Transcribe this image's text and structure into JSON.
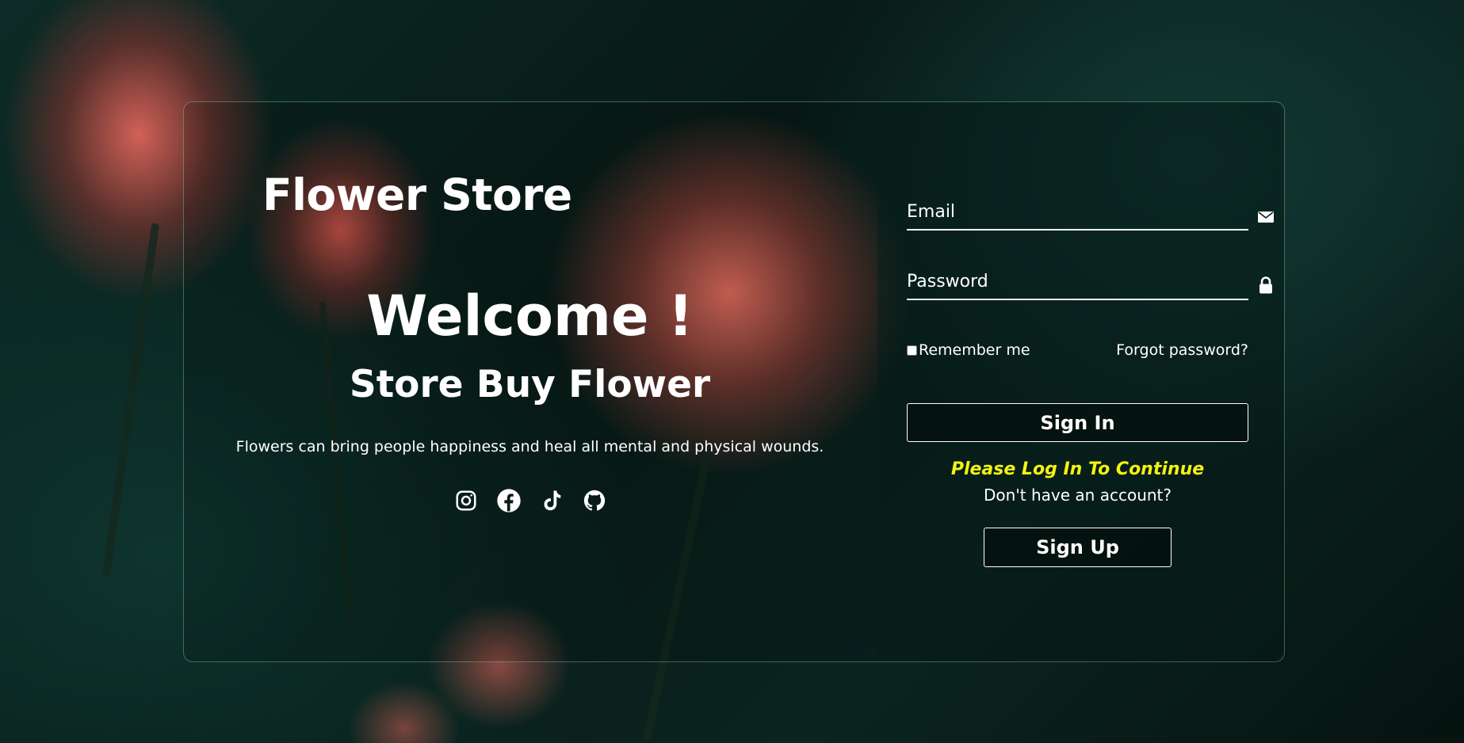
{
  "brand": {
    "title": "Flower Store"
  },
  "hero": {
    "welcome": "Welcome !",
    "subtitle": "Store Buy Flower",
    "tagline": "Flowers can bring people happiness and heal all mental and physical wounds."
  },
  "socials": [
    {
      "icon": "instagram-icon"
    },
    {
      "icon": "facebook-icon"
    },
    {
      "icon": "tiktok-icon"
    },
    {
      "icon": "github-icon"
    }
  ],
  "form": {
    "email": {
      "placeholder": "Email",
      "value": "",
      "icon": "envelope-icon"
    },
    "password": {
      "placeholder": "Password",
      "value": "",
      "icon": "lock-icon"
    },
    "remember_label": "Remember me",
    "remember_checked": false,
    "forgot_label": "Forgot password?",
    "signin_label": "Sign In",
    "prompt": "Please Log In To Continue",
    "no_account": "Don't have an account?",
    "signup_label": "Sign Up"
  },
  "colors": {
    "accent_yellow": "#f3f312",
    "text": "#ffffff",
    "background": "#0b2420"
  }
}
